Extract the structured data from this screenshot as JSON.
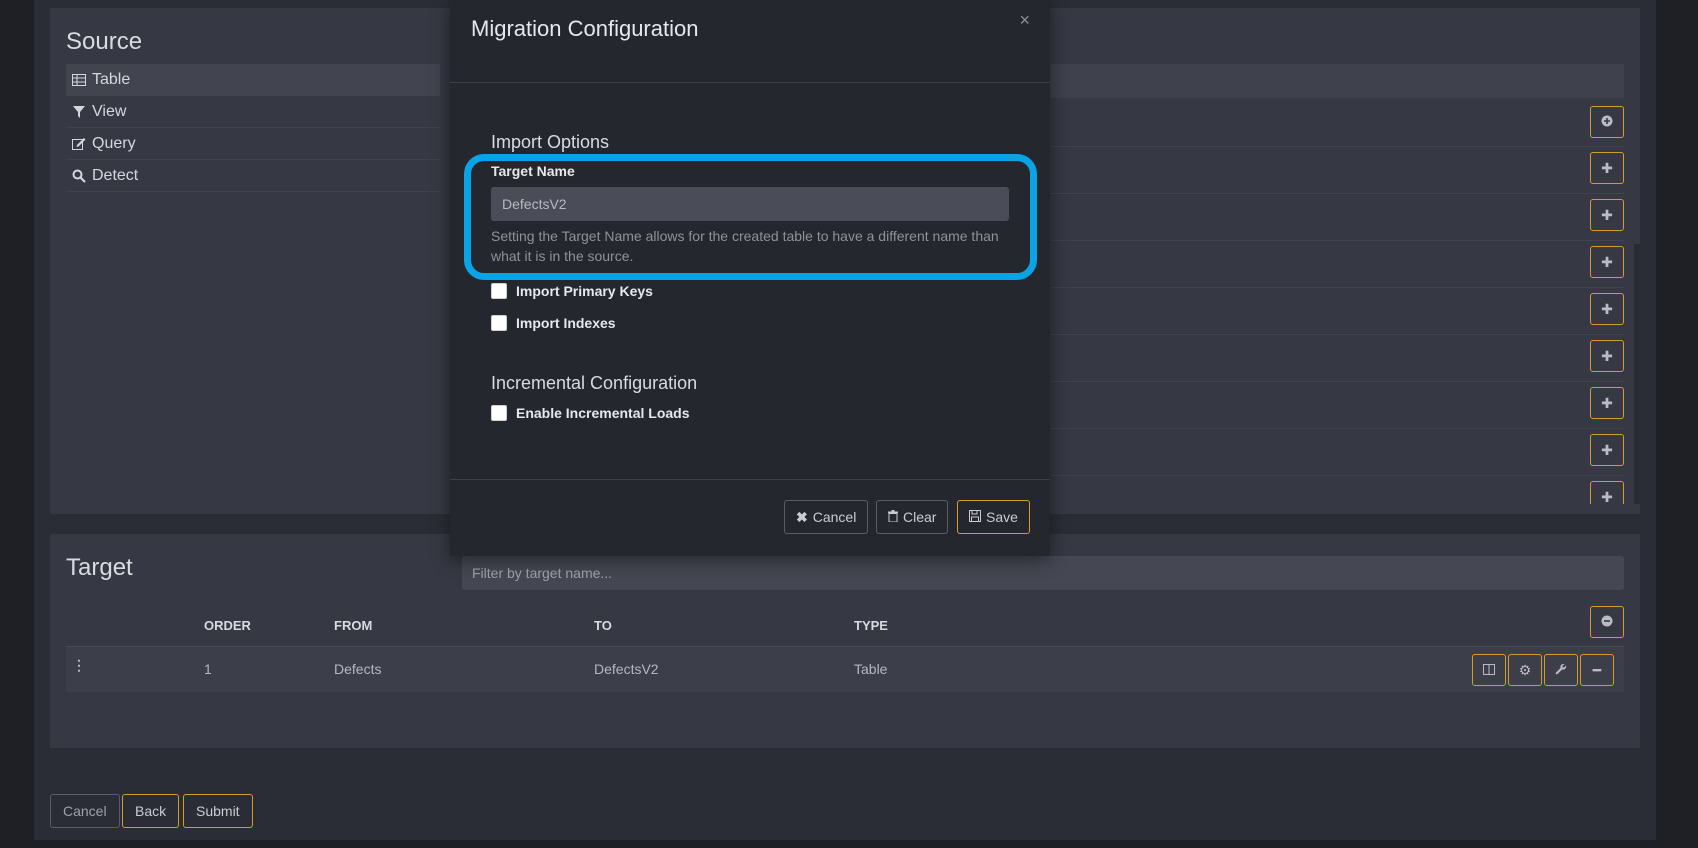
{
  "source": {
    "title": "Source",
    "nav": [
      {
        "label": "Table",
        "icon": "table-icon"
      },
      {
        "label": "View",
        "icon": "filter-icon"
      },
      {
        "label": "Query",
        "icon": "edit-icon"
      },
      {
        "label": "Detect",
        "icon": "search-icon"
      }
    ]
  },
  "target": {
    "title": "Target",
    "filter_placeholder": "Filter by target name...",
    "columns": [
      "ORDER",
      "FROM",
      "TO",
      "TYPE"
    ],
    "rows": [
      {
        "order": "1",
        "from": "Defects",
        "to": "DefectsV2",
        "type": "Table"
      }
    ]
  },
  "footer": {
    "cancel": "Cancel",
    "back": "Back",
    "submit": "Submit"
  },
  "modal": {
    "title": "Migration Configuration",
    "close": "×",
    "import_options_title": "Import Options",
    "target_name_label": "Target Name",
    "target_name_value": "DefectsV2",
    "target_name_help": "Setting the Target Name allows for the created table to have a different name than what it is in the source.",
    "import_primary_keys": "Import Primary Keys",
    "import_indexes": "Import Indexes",
    "incremental_title": "Incremental Configuration",
    "enable_incremental": "Enable Incremental Loads",
    "cancel": "Cancel",
    "clear": "Clear",
    "save": "Save"
  },
  "colors": {
    "accent_gold": "#d69a2d",
    "highlight_blue": "#0aa4e6"
  }
}
